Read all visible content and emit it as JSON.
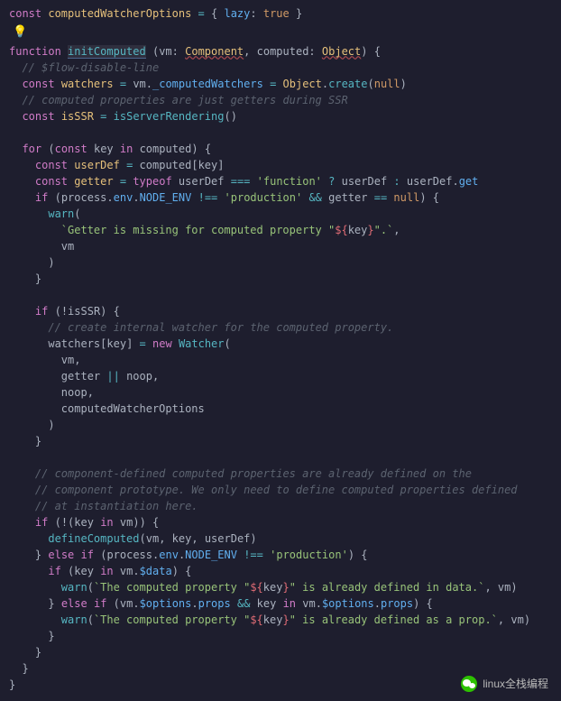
{
  "code": {
    "l1a": "const",
    "l1b": "computedWatcherOptions",
    "l1c": "lazy",
    "l1d": "true",
    "l3a": "function",
    "l3b": "initComputed",
    "l3c": "vm",
    "l3d": "Component",
    "l3e": "computed",
    "l3f": "Object",
    "l4a": "// $flow-disable-line",
    "l5a": "const",
    "l5b": "watchers",
    "l5c": "vm",
    "l5d": "_computedWatchers",
    "l5e": "Object",
    "l5f": "create",
    "l5g": "null",
    "l6a": "// computed properties are just getters during SSR",
    "l7a": "const",
    "l7b": "isSSR",
    "l7c": "isServerRendering",
    "l9a": "for",
    "l9b": "const",
    "l9c": "key",
    "l9d": "in",
    "l9e": "computed",
    "l10a": "const",
    "l10b": "userDef",
    "l10c": "computed",
    "l10d": "key",
    "l11a": "const",
    "l11b": "getter",
    "l11c": "typeof",
    "l11d": "userDef",
    "l11e": "'function'",
    "l11f": "userDef",
    "l11g": "userDef",
    "l11h": "get",
    "l12a": "if",
    "l12b": "process",
    "l12c": "env",
    "l12d": "NODE_ENV",
    "l12e": "'production'",
    "l12f": "getter",
    "l12g": "null",
    "l13a": "warn",
    "l14a": "`Getter is missing for computed property \"",
    "l14b": "key",
    "l14c": "\".`",
    "l15a": "vm",
    "l19a": "if",
    "l19b": "isSSR",
    "l20a": "// create internal watcher for the computed property.",
    "l21a": "watchers",
    "l21b": "key",
    "l21c": "new",
    "l21d": "Watcher",
    "l22a": "vm",
    "l23a": "getter",
    "l23b": "noop",
    "l24a": "noop",
    "l25a": "computedWatcherOptions",
    "l29a": "// component-defined computed properties are already defined on the",
    "l30a": "// component prototype. We only need to define computed properties defined",
    "l31a": "// at instantiation here.",
    "l32a": "if",
    "l32b": "key",
    "l32c": "in",
    "l32d": "vm",
    "l33a": "defineComputed",
    "l33b": "vm",
    "l33c": "key",
    "l33d": "userDef",
    "l34a": "else",
    "l34b": "if",
    "l34c": "process",
    "l34d": "env",
    "l34e": "NODE_ENV",
    "l34f": "'production'",
    "l35a": "if",
    "l35b": "key",
    "l35c": "in",
    "l35d": "vm",
    "l35e": "$data",
    "l36a": "warn",
    "l36b": "`The computed property \"",
    "l36c": "key",
    "l36d": "\" is already defined in data.`",
    "l36e": "vm",
    "l37a": "else",
    "l37b": "if",
    "l37c": "vm",
    "l37d": "$options",
    "l37e": "props",
    "l37f": "key",
    "l37g": "in",
    "l37h": "vm",
    "l37i": "$options",
    "l37j": "props",
    "l38a": "warn",
    "l38b": "`The computed property \"",
    "l38c": "key",
    "l38d": "\" is already defined as a prop.`",
    "l38e": "vm"
  },
  "watermark": "linux全栈编程"
}
